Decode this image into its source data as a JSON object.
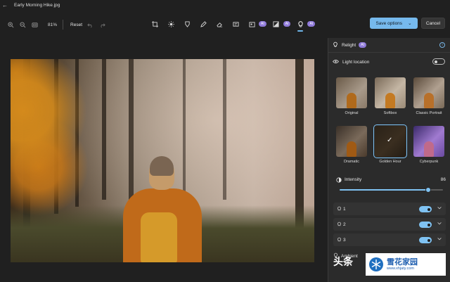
{
  "window": {
    "title": "Early Morning Hike.jpg"
  },
  "toolbar": {
    "zoom_value": "81%",
    "reset_label": "Reset",
    "ai_badge": "AI",
    "save_label": "Save options",
    "cancel_label": "Cancel"
  },
  "panel": {
    "title": "Relight",
    "ai_badge": "AI",
    "light_location_label": "Light location",
    "presets": [
      {
        "label": "Original"
      },
      {
        "label": "Softbox"
      },
      {
        "label": "Classic Portrait"
      },
      {
        "label": "Dramatic"
      },
      {
        "label": "Golden Hour",
        "selected": true
      },
      {
        "label": "Cyberpunk"
      }
    ],
    "intensity_label": "Intensity",
    "intensity_value": "86",
    "intensity_fraction": 0.86,
    "lights": [
      {
        "label": "1",
        "enabled": true
      },
      {
        "label": "2",
        "enabled": true
      },
      {
        "label": "3",
        "enabled": true
      }
    ],
    "ambient_label": "Ambient"
  },
  "watermark": {
    "left_text": "头条",
    "brand_text": "雪花家园",
    "brand_url": "www.xhjaty.com"
  },
  "colors": {
    "accent": "#76b9ed",
    "ai_badge": "#8f7ad9",
    "panel_bg": "#2b2b2b",
    "app_bg": "#202020"
  }
}
